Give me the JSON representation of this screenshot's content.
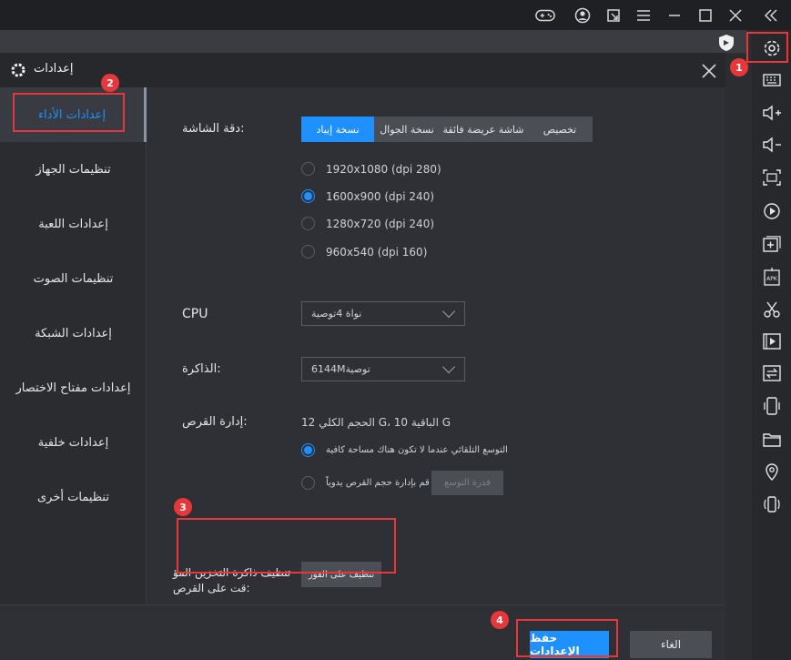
{
  "dialog": {
    "title": "إعدادات"
  },
  "sidebar": {
    "items": [
      {
        "label": "إعدادات الأداء"
      },
      {
        "label": "تنظيمات الجهاز"
      },
      {
        "label": "إعدادات اللعبة"
      },
      {
        "label": "تنظيمات الصوت"
      },
      {
        "label": "إعدادات الشبكة"
      },
      {
        "label": "إعدادات مفتاح الاختصار"
      },
      {
        "label": "إعدادات خلفية"
      },
      {
        "label": "تنظيمات أخرى"
      }
    ]
  },
  "resolution": {
    "label": "دقة الشاشة:",
    "tabs": [
      {
        "label": "نسخة إيباد"
      },
      {
        "label": "نسخة الجوال"
      },
      {
        "label": "شاشة عريضة فائقة"
      },
      {
        "label": "تخصيص"
      }
    ],
    "options": [
      {
        "label": "1920x1080  (dpi 280)"
      },
      {
        "label": "1600x900  (dpi 240)"
      },
      {
        "label": "1280x720  (dpi 240)"
      },
      {
        "label": "960x540  (dpi 160)"
      }
    ]
  },
  "cpu": {
    "label": "CPU",
    "value": "نواة 4توصية"
  },
  "memory": {
    "label": "الذاكرة:",
    "value": "6144Mتوصية"
  },
  "disk": {
    "label": "إدارة القرص:",
    "info": "12 الحجم الكلي G، 10 الباقية G",
    "option_auto": "التوسع التلقائي عندما لا تكون هناك مساحة كافية",
    "option_manual": "قم بإدارة حجم القرص يدوياً",
    "expand_button": "قدرة التوسع"
  },
  "cache": {
    "label_line1": "تنظيف ذاكرة التخزين المؤ",
    "label_line2": "قت على القرص:",
    "clean_button": "تنظيف على الفور"
  },
  "footer": {
    "save_button": "حفظ الإعدادات",
    "cancel_button": "الغاء"
  },
  "badges": [
    "1",
    "2",
    "3",
    "4"
  ],
  "colors": {
    "accent": "#1e90ff",
    "highlight": "#e8373a"
  }
}
